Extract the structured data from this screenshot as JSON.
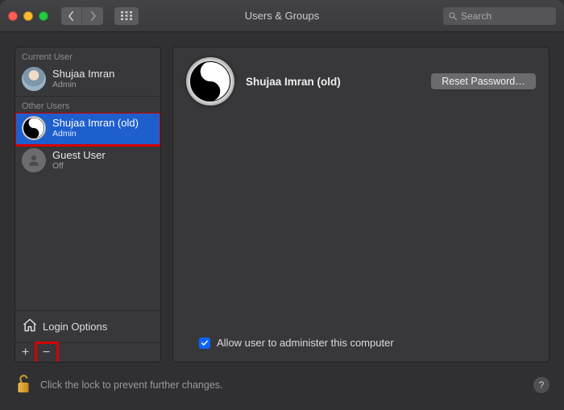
{
  "window": {
    "title": "Users & Groups"
  },
  "search": {
    "placeholder": "Search"
  },
  "sidebar": {
    "current_label": "Current User",
    "other_label": "Other Users",
    "login_options": "Login Options",
    "current": {
      "name": "Shujaa Imran",
      "role": "Admin"
    },
    "others": [
      {
        "name": "Shujaa Imran (old)",
        "role": "Admin",
        "selected": true,
        "avatar": "yin"
      },
      {
        "name": "Guest User",
        "role": "Off",
        "selected": false,
        "avatar": "guest"
      }
    ]
  },
  "detail": {
    "name": "Shujaa Imran (old)",
    "reset_button": "Reset Password…",
    "admin_checkbox_label": "Allow user to administer this computer",
    "admin_checked": true
  },
  "footer": {
    "lock_text": "Click the lock to prevent further changes."
  }
}
